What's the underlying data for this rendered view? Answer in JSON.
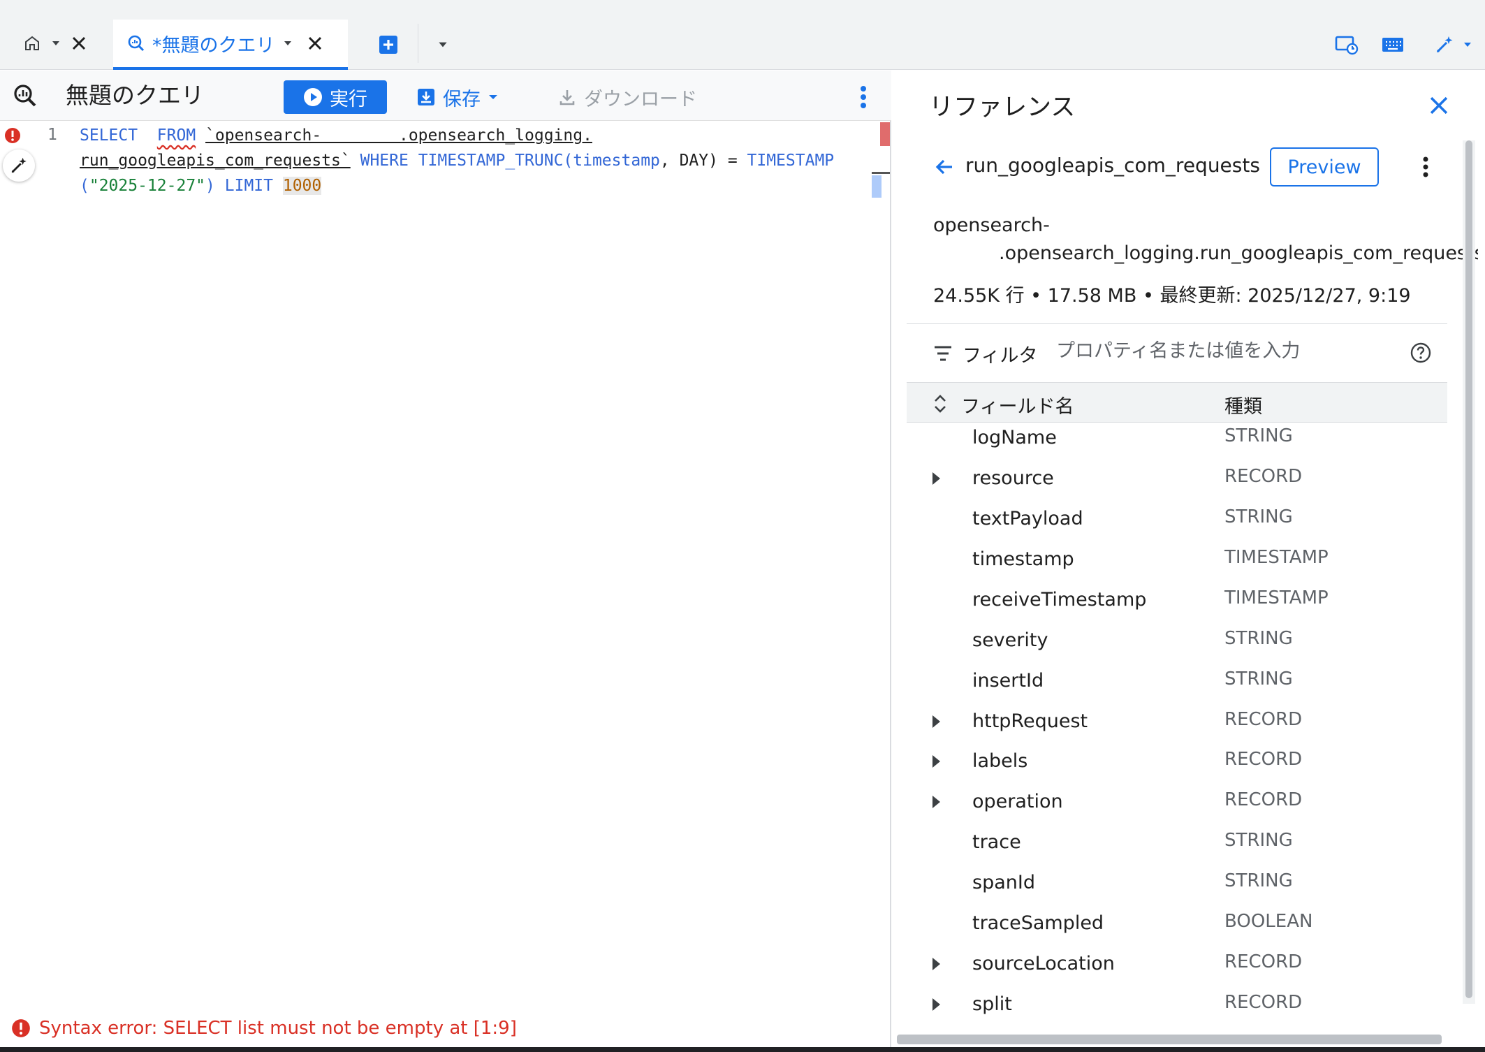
{
  "tabs": {
    "home_tab": {
      "icon": "home-icon"
    },
    "query_tab": {
      "label": "*無題のクエリ"
    }
  },
  "editor": {
    "query_name": "無題のクエリ",
    "run_label": "実行",
    "save_label": "保存",
    "download_label": "ダウンロード",
    "line_number": "1",
    "code": {
      "l1_select": "SELECT",
      "l1_from": "FROM",
      "l1_table_a": "`opensearch-        .opensearch_logging.",
      "l2_table_b": "run_googleapis_com_requests`",
      "l2_where": "WHERE",
      "l2_fn": "TIMESTAMP_TRUNC(",
      "l2_arg": "timestamp",
      "l2_rest": ", DAY) = ",
      "l2_ts": "TIMESTAMP",
      "l3_open": "(",
      "l3_str": "\"2025-12-27\"",
      "l3_close": ")",
      "l3_limit": "LIMIT",
      "l3_num": "1000"
    },
    "error_message": "Syntax error: SELECT list must not be empty at [1:9]"
  },
  "reference": {
    "title": "リファレンス",
    "table_name": "run_googleapis_com_requests",
    "preview_label": "Preview",
    "path_line1": "opensearch-",
    "path_line2": ".opensearch_logging.run_googleapis_com_requests",
    "stats": "24.55K 行 • 17.58 MB • 最終更新: 2025/12/27, 9:19",
    "filter_label": "フィルタ",
    "filter_placeholder": "プロパティ名または値を入力",
    "col_field": "フィールド名",
    "col_type": "種類",
    "fields": [
      {
        "name": "logName",
        "type": "STRING",
        "expandable": false
      },
      {
        "name": "resource",
        "type": "RECORD",
        "expandable": true
      },
      {
        "name": "textPayload",
        "type": "STRING",
        "expandable": false
      },
      {
        "name": "timestamp",
        "type": "TIMESTAMP",
        "expandable": false
      },
      {
        "name": "receiveTimestamp",
        "type": "TIMESTAMP",
        "expandable": false
      },
      {
        "name": "severity",
        "type": "STRING",
        "expandable": false
      },
      {
        "name": "insertId",
        "type": "STRING",
        "expandable": false
      },
      {
        "name": "httpRequest",
        "type": "RECORD",
        "expandable": true
      },
      {
        "name": "labels",
        "type": "RECORD",
        "expandable": true
      },
      {
        "name": "operation",
        "type": "RECORD",
        "expandable": true
      },
      {
        "name": "trace",
        "type": "STRING",
        "expandable": false
      },
      {
        "name": "spanId",
        "type": "STRING",
        "expandable": false
      },
      {
        "name": "traceSampled",
        "type": "BOOLEAN",
        "expandable": false
      },
      {
        "name": "sourceLocation",
        "type": "RECORD",
        "expandable": true
      },
      {
        "name": "split",
        "type": "RECORD",
        "expandable": true
      }
    ]
  },
  "colors": {
    "accent": "#1a73e8",
    "error": "#d93025",
    "keyword": "#3367d6",
    "string": "#188038",
    "number": "#b06000"
  }
}
